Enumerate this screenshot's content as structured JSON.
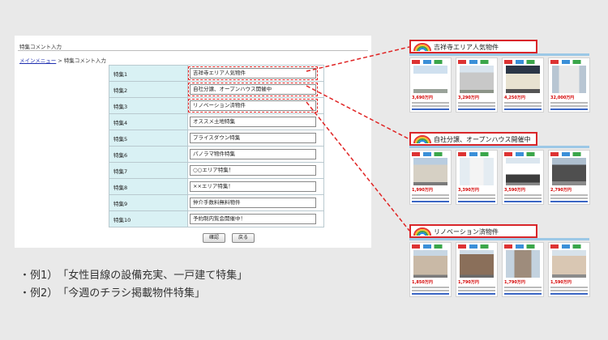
{
  "form_panel": {
    "title": "特集コメント入力",
    "breadcrumb": {
      "link": "メインメニュー",
      "separator": " > ",
      "current": "特集コメント入力"
    },
    "rows": [
      {
        "label": "特集1",
        "value": "吉祥寺エリア人気物件",
        "highlighted": true
      },
      {
        "label": "特集2",
        "value": "自社分譲、オープンハウス開催中",
        "highlighted": true
      },
      {
        "label": "特集3",
        "value": "リノベーション済物件",
        "highlighted": true
      },
      {
        "label": "特集4",
        "value": "オススメ土地特集"
      },
      {
        "label": "特集5",
        "value": "プライスダウン特集"
      },
      {
        "label": "特集6",
        "value": "パノラマ物件特集"
      },
      {
        "label": "特集7",
        "value": "○○エリア特集！"
      },
      {
        "label": "特集8",
        "value": "××エリア特集！"
      },
      {
        "label": "特集9",
        "value": "仲介手数料無料物件"
      },
      {
        "label": "特集10",
        "value": "予約制内覧会開催中！"
      }
    ],
    "confirm_button": "確認",
    "back_button": "戻る"
  },
  "examples": [
    "・例1）　「女性目線の設備充実、一戸建て特集」",
    "・例2）　「今週のチラシ掲載物件特集」"
  ],
  "colors": {
    "accent": "#d9262a",
    "label_bg": "#d9f1f4",
    "link": "#1f2fb0",
    "price": "#d40000"
  },
  "featured_sections": [
    {
      "title": "吉祥寺エリア人気物件",
      "icon": "rainbow-icon",
      "listings": [
        {
          "price": "3,690万円",
          "image": "house-white"
        },
        {
          "price": "3,290万円",
          "image": "house-gray"
        },
        {
          "price": "4,250万円",
          "image": "house-night"
        },
        {
          "price": "32,000万円",
          "image": "building-tall"
        }
      ]
    },
    {
      "title": "自社分譲、オープンハウス開催中",
      "icon": "rainbow-icon",
      "listings": [
        {
          "price": "1,990万円",
          "image": "apartment"
        },
        {
          "price": "3,390万円",
          "image": "house-narrow"
        },
        {
          "price": "3,590万円",
          "image": "house-modern"
        },
        {
          "price": "2,790万円",
          "image": "house-dark"
        }
      ]
    },
    {
      "title": "リノベーション済物件",
      "icon": "rainbow-icon",
      "listings": [
        {
          "price": "1,850万円",
          "image": "mansion"
        },
        {
          "price": "1,790万円",
          "image": "mansion-brown"
        },
        {
          "price": "1,790万円",
          "image": "mansion-tall"
        },
        {
          "price": "1,590万円",
          "image": "mansion-wide"
        }
      ]
    }
  ]
}
